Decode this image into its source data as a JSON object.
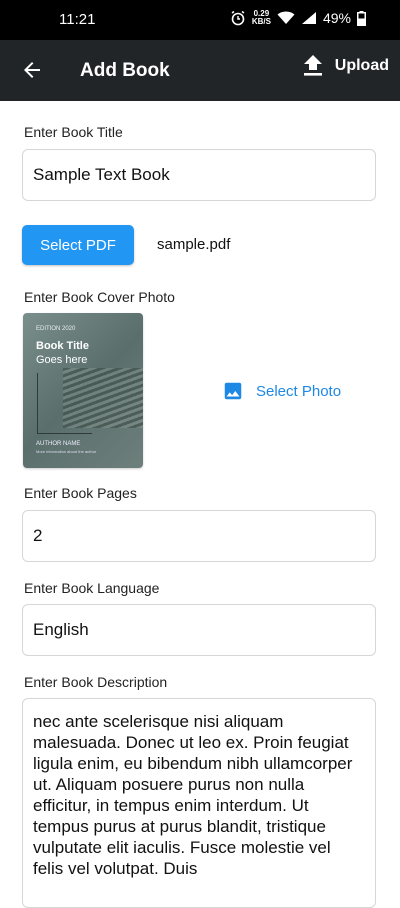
{
  "status_bar": {
    "time": "11:21",
    "speed_value": "0.29",
    "speed_unit": "KB/S",
    "battery": "49%"
  },
  "app_bar": {
    "title": "Add Book",
    "upload_label": "Upload"
  },
  "form": {
    "title_label": "Enter Book Title",
    "title_value": "Sample Text Book",
    "select_pdf_label": "Select PDF",
    "pdf_filename": "sample.pdf",
    "cover_label": "Enter Book Cover Photo",
    "cover_image": {
      "edition": "EDITION 2020",
      "book_title": "Book Title",
      "subtitle": "Goes here",
      "author": "AUTHOR NAME",
      "author_info": "More information about the author"
    },
    "select_photo_label": "Select Photo",
    "pages_label": "Enter Book Pages",
    "pages_value": "2",
    "language_label": "Enter Book Language",
    "language_value": "English",
    "description_label": "Enter Book Description",
    "description_value": "nec ante scelerisque nisi aliquam malesuada. Donec ut leo ex. Proin feugiat ligula enim, eu bibendum nibh ullamcorper ut. Aliquam posuere purus non nulla efficitur, in tempus enim interdum. Ut tempus purus at purus blandit, tristique vulputate elit iaculis. Fusce molestie vel felis vel volutpat. Duis"
  },
  "colors": {
    "app_bar": "#212528",
    "accent": "#2196f3",
    "link": "#1e88e5"
  },
  "icons": [
    "back-arrow-icon",
    "upload-icon",
    "image-icon",
    "alarm-icon",
    "wifi-icon",
    "signal-icon",
    "battery-icon"
  ]
}
